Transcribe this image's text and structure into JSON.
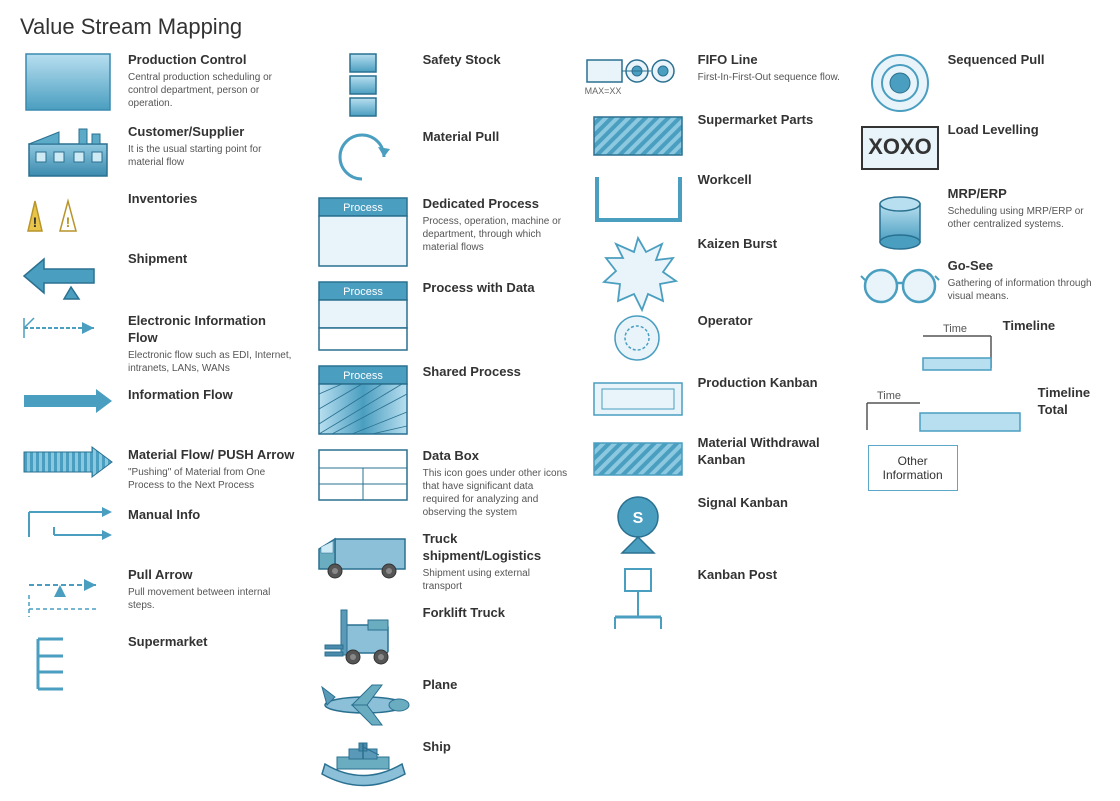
{
  "title": "Value Stream Mapping",
  "columns": {
    "col1": {
      "items": [
        {
          "id": "production-control",
          "title": "Production Control",
          "desc": "Central production scheduling or control department, person or operation."
        },
        {
          "id": "customer-supplier",
          "title": "Customer/Supplier",
          "desc": "It is the usual starting point for material flow"
        },
        {
          "id": "inventories",
          "title": "Inventories",
          "desc": ""
        },
        {
          "id": "shipment",
          "title": "Shipment",
          "desc": ""
        },
        {
          "id": "electronic-info-flow",
          "title": "Electronic Information Flow",
          "desc": "Electronic flow such as EDI, Internet, intranets, LANs, WANs"
        },
        {
          "id": "information-flow",
          "title": "Information Flow",
          "desc": ""
        },
        {
          "id": "material-flow-push",
          "title": "Material Flow/ PUSH Arrow",
          "desc": "\"Pushing\" of Material from One Process to the Next Process"
        },
        {
          "id": "manual-info",
          "title": "Manual Info",
          "desc": ""
        },
        {
          "id": "pull-arrow",
          "title": "Pull Arrow",
          "desc": "Pull movement between internal steps."
        },
        {
          "id": "supermarket",
          "title": "Supermarket",
          "desc": ""
        }
      ]
    },
    "col2": {
      "items": [
        {
          "id": "safety-stock",
          "title": "Safety Stock",
          "desc": ""
        },
        {
          "id": "material-pull",
          "title": "Material Pull",
          "desc": ""
        },
        {
          "id": "dedicated-process",
          "title": "Dedicated Process",
          "desc": "Process, operation, machine or department, through which material flows"
        },
        {
          "id": "process-with-data",
          "title": "Process with Data",
          "desc": ""
        },
        {
          "id": "shared-process",
          "title": "Shared Process",
          "desc": ""
        },
        {
          "id": "data-box",
          "title": "Data Box",
          "desc": "This icon goes under other icons that have significant data required for analyzing and observing the system"
        },
        {
          "id": "truck-shipment",
          "title": "Truck shipment/Logistics",
          "desc": "Shipment using external transport"
        },
        {
          "id": "forklift-truck",
          "title": "Forklift Truck",
          "desc": ""
        },
        {
          "id": "plane",
          "title": "Plane",
          "desc": ""
        },
        {
          "id": "ship",
          "title": "Ship",
          "desc": ""
        }
      ]
    },
    "col3": {
      "items": [
        {
          "id": "fifo-line",
          "title": "FIFO Line",
          "desc": "First-In-First-Out sequence flow.",
          "sub": "MAX=XX"
        },
        {
          "id": "supermarket-parts",
          "title": "Supermarket Parts",
          "desc": ""
        },
        {
          "id": "workcell",
          "title": "Workcell",
          "desc": ""
        },
        {
          "id": "kaizen-burst",
          "title": "Kaizen Burst",
          "desc": ""
        },
        {
          "id": "operator",
          "title": "Operator",
          "desc": ""
        },
        {
          "id": "production-kanban",
          "title": "Production Kanban",
          "desc": ""
        },
        {
          "id": "material-withdrawal-kanban",
          "title": "Material Withdrawal Kanban",
          "desc": ""
        },
        {
          "id": "signal-kanban",
          "title": "Signal Kanban",
          "desc": ""
        },
        {
          "id": "kanban-post",
          "title": "Kanban Post",
          "desc": ""
        }
      ]
    },
    "col4": {
      "items": [
        {
          "id": "sequenced-pull",
          "title": "Sequenced Pull",
          "desc": ""
        },
        {
          "id": "load-levelling",
          "title": "Load Levelling",
          "desc": ""
        },
        {
          "id": "mrp-erp",
          "title": "MRP/ERP",
          "desc": "Scheduling using MRP/ERP or other centralized systems."
        },
        {
          "id": "go-see",
          "title": "Go-See",
          "desc": "Gathering of information through visual means."
        },
        {
          "id": "timeline",
          "title": "Timeline",
          "desc": ""
        },
        {
          "id": "timeline-total",
          "title": "Timeline Total",
          "desc": ""
        },
        {
          "id": "other-information",
          "title": "Other Information",
          "desc": ""
        }
      ]
    }
  }
}
